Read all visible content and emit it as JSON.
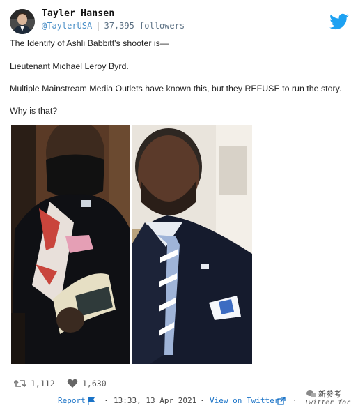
{
  "author": {
    "name": "Tayler Hansen",
    "handle": "@TaylerUSA",
    "followers": "37,395 followers"
  },
  "tweet": {
    "lines": [
      "The Identify of Ashli Babbitt's shooter is—",
      "Lieutenant Michael Leroy Byrd.",
      "Multiple Mainstream Media Outlets have known this, but they REFUSE to run the story.",
      "Why is that?"
    ]
  },
  "stats": {
    "retweets": "1,112",
    "likes": "1,630"
  },
  "footer": {
    "report": "Report",
    "timestamp": "13:33, 13 Apr 2021",
    "view_on_twitter": "View on Twitter"
  },
  "watermark": {
    "brand": "新参考",
    "sub": "Twitter for"
  },
  "icons": {
    "bird": "twitter-bird-icon",
    "retweet": "retweet-icon",
    "like": "heart-icon",
    "flag": "flag-icon",
    "external": "external-link-icon"
  },
  "colors": {
    "twitter_blue": "#1da1f2",
    "link": "#1a73c7"
  }
}
